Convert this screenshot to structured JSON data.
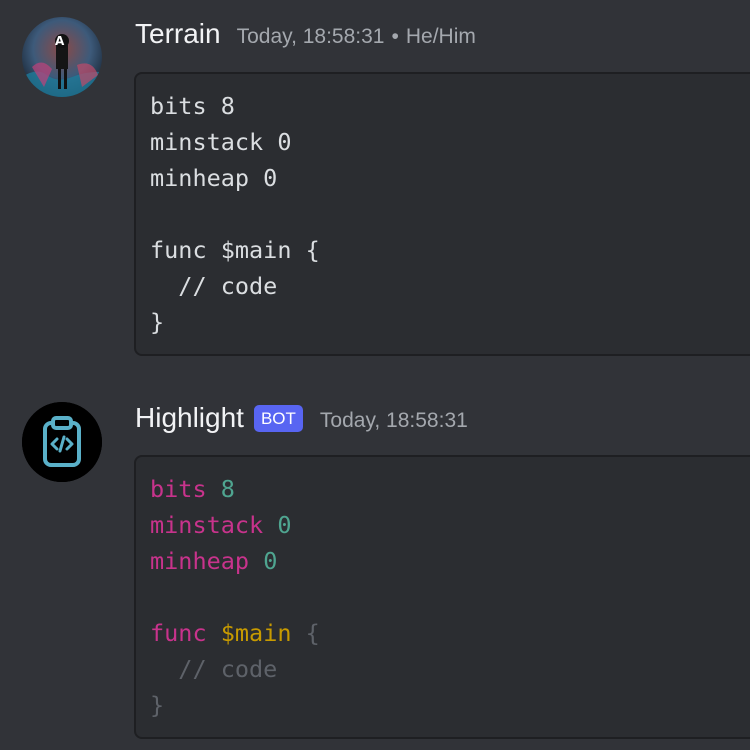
{
  "messages": [
    {
      "author": "Terrain",
      "timestamp": "Today, 18:58:31",
      "separator": "•",
      "pronouns": "He/Him",
      "code_lines": [
        "bits 8",
        "minstack 0",
        "minheap 0",
        "",
        "func $main {",
        "  // code",
        "}"
      ]
    },
    {
      "author": "Highlight",
      "bot_tag": "BOT",
      "timestamp": "Today, 18:58:31",
      "highlighted": {
        "bits_kw": "bits",
        "bits_val": "8",
        "minstack_kw": "minstack",
        "minstack_val": "0",
        "minheap_kw": "minheap",
        "minheap_val": "0",
        "func_kw": "func",
        "func_name": "$main",
        "open_brace": "{",
        "indent": "  ",
        "comment": "// code",
        "close_brace": "}"
      }
    }
  ],
  "colors": {
    "background": "#313338",
    "codeblock": "#2b2d31",
    "keyword": "#c8338c",
    "number": "#4fa590",
    "function": "#c79a00",
    "comment": "#5e6269",
    "bot_tag": "#5865f2"
  },
  "icons": {
    "terrain_avatar": "user-avatar",
    "highlight_avatar": "clipboard-code-icon"
  }
}
